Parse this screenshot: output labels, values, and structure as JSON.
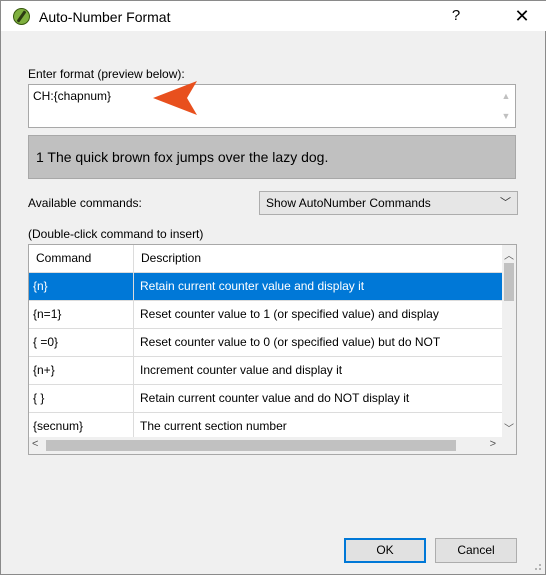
{
  "window": {
    "title": "Auto-Number Format",
    "help_label": "?",
    "close_label": "✕"
  },
  "format": {
    "label": "Enter format (preview below):",
    "value": "CH:{chapnum}"
  },
  "preview": {
    "text": "1  The quick brown fox jumps over the lazy dog."
  },
  "commands": {
    "available_label": "Available commands:",
    "selected_option": "Show AutoNumber Commands",
    "hint": "(Double-click command to insert)",
    "columns": [
      "Command",
      "Description"
    ],
    "rows": [
      {
        "command": "{n}",
        "description": "Retain current counter value and display it"
      },
      {
        "command": "{n=1}",
        "description": "Reset counter value to 1 (or specified value) and display"
      },
      {
        "command": "{ =0}",
        "description": "Reset counter value to 0 (or specified value) but do NOT"
      },
      {
        "command": "{n+}",
        "description": "Increment counter value and display it"
      },
      {
        "command": "{ }",
        "description": "Retain current counter value and do NOT display it"
      },
      {
        "command": "{secnum}",
        "description": "The current section number"
      }
    ]
  },
  "buttons": {
    "ok": "OK",
    "cancel": "Cancel"
  },
  "colors": {
    "selection": "#0078d7",
    "annotation_arrow": "#e8501e",
    "preview_bg": "#c0c0c0"
  }
}
